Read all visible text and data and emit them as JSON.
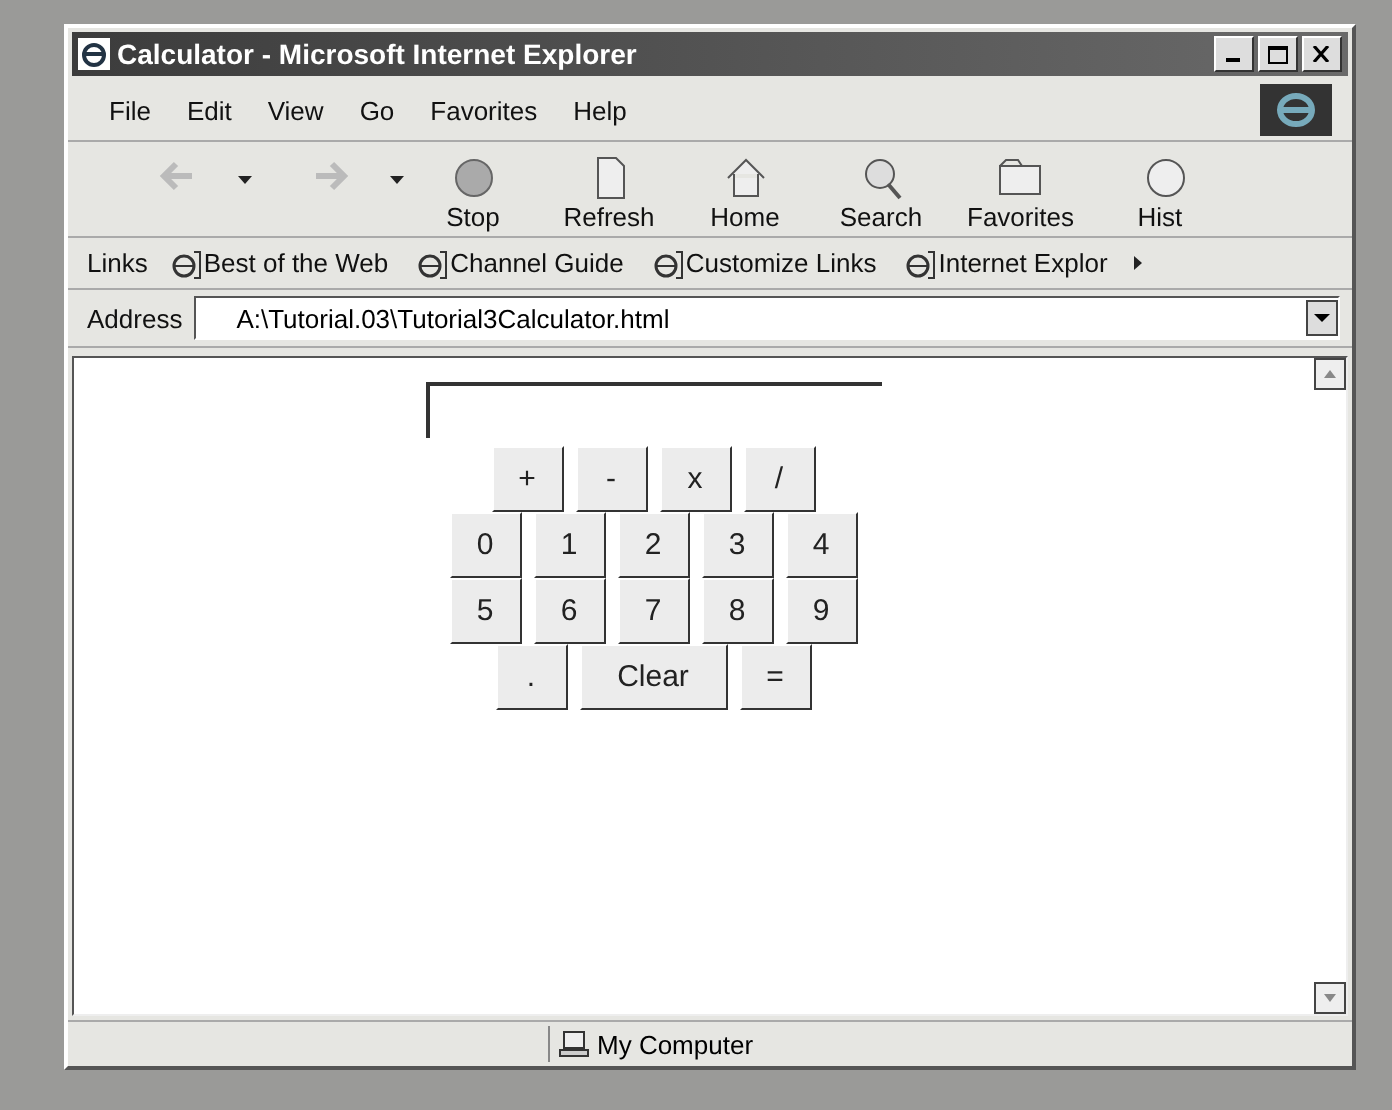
{
  "window": {
    "title": "Calculator - Microsoft Internet Explorer"
  },
  "menu": [
    "File",
    "Edit",
    "View",
    "Go",
    "Favorites",
    "Help"
  ],
  "toolbar": [
    {
      "kind": "back",
      "disabled": true
    },
    {
      "kind": "forward",
      "disabled": true
    },
    {
      "kind": "stop",
      "label": "Stop",
      "disabled": false
    },
    {
      "kind": "refresh",
      "label": "Refresh",
      "disabled": false
    },
    {
      "kind": "home",
      "label": "Home",
      "disabled": false
    },
    {
      "kind": "search",
      "label": "Search",
      "disabled": false
    },
    {
      "kind": "favorites",
      "label": "Favorites",
      "disabled": false
    },
    {
      "kind": "history",
      "label": "Hist",
      "disabled": false
    }
  ],
  "links": {
    "label": "Links",
    "items": [
      "Best of the Web",
      "Channel Guide",
      "Customize Links",
      "Internet Explor"
    ]
  },
  "address": {
    "label": "Address",
    "value": "A:\\Tutorial.03\\Tutorial3Calculator.html"
  },
  "calculator": {
    "keys": [
      [
        "+",
        "-",
        "x",
        "/"
      ],
      [
        "0",
        "1",
        "2",
        "3",
        "4"
      ],
      [
        "5",
        "6",
        "7",
        "8",
        "9"
      ],
      [
        ".",
        "Clear",
        "="
      ]
    ]
  },
  "status_bar": {
    "zone": "My Computer"
  }
}
